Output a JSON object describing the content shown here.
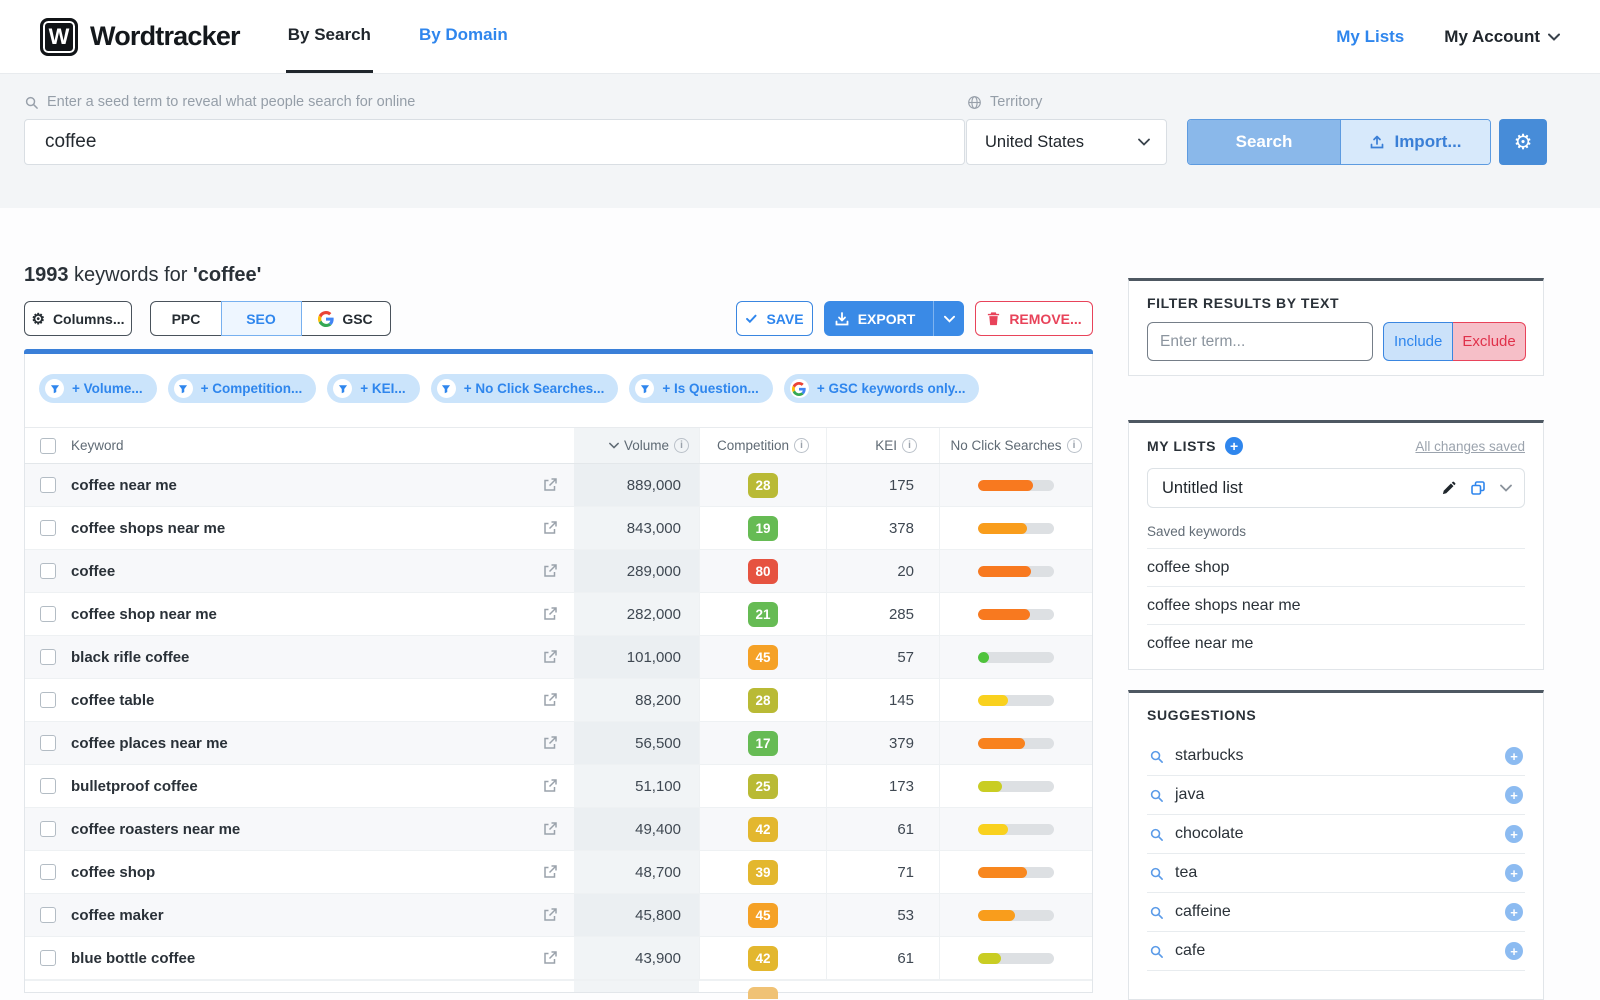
{
  "navbar": {
    "logo_letter": "W",
    "brand": "Wordtracker",
    "tab_by_search": "By Search",
    "tab_by_domain": "By Domain",
    "my_lists": "My Lists",
    "my_account": "My Account"
  },
  "search_panel": {
    "seed_label": "Enter a seed term to reveal what people search for online",
    "seed_value": "coffee",
    "territory_label": "Territory",
    "territory_value": "United States",
    "search_button": "Search",
    "import_button": "Import...",
    "accent_color": "#478cd8"
  },
  "results": {
    "count": "1993",
    "count_suffix": " keywords for ",
    "term": "'coffee'",
    "columns_button": "Columns...",
    "modes": {
      "ppc": "PPC",
      "seo": "SEO",
      "gsc": "GSC",
      "selected": "SEO"
    },
    "save_button": "SAVE",
    "export_button": "EXPORT",
    "remove_button": "REMOVE...",
    "filter_chips": [
      {
        "label": "+ Volume...",
        "icon": "funnel"
      },
      {
        "label": "+ Competition...",
        "icon": "funnel"
      },
      {
        "label": "+ KEI...",
        "icon": "funnel"
      },
      {
        "label": "+ No Click Searches...",
        "icon": "funnel"
      },
      {
        "label": "+ Is Question...",
        "icon": "funnel"
      },
      {
        "label": "+ GSC keywords only...",
        "icon": "google"
      }
    ],
    "table": {
      "headers": [
        "Keyword",
        "Volume",
        "Competition",
        "KEI",
        "No Click Searches"
      ],
      "rows": [
        {
          "keyword": "coffee near me",
          "volume": "889,000",
          "competition": "28",
          "competition_color": "#b9ba35",
          "kei": "175",
          "bar_pct": 72,
          "bar_color": "#f8791f"
        },
        {
          "keyword": "coffee shops near me",
          "volume": "843,000",
          "competition": "19",
          "competition_color": "#66bb54",
          "kei": "378",
          "bar_pct": 64,
          "bar_color": "#f99d1c"
        },
        {
          "keyword": "coffee",
          "volume": "289,000",
          "competition": "80",
          "competition_color": "#e65340",
          "kei": "20",
          "bar_pct": 70,
          "bar_color": "#f8791f"
        },
        {
          "keyword": "coffee shop near me",
          "volume": "282,000",
          "competition": "21",
          "competition_color": "#66bb54",
          "kei": "285",
          "bar_pct": 68,
          "bar_color": "#f8791f"
        },
        {
          "keyword": "black rifle coffee",
          "volume": "101,000",
          "competition": "45",
          "competition_color": "#f5a126",
          "kei": "57",
          "bar_pct": 14,
          "bar_color": "#4fc33c"
        },
        {
          "keyword": "coffee table",
          "volume": "88,200",
          "competition": "28",
          "competition_color": "#b9ba35",
          "kei": "145",
          "bar_pct": 40,
          "bar_color": "#f9d11e"
        },
        {
          "keyword": "coffee places near me",
          "volume": "56,500",
          "competition": "17",
          "competition_color": "#66bb54",
          "kei": "379",
          "bar_pct": 62,
          "bar_color": "#f8821e"
        },
        {
          "keyword": "bulletproof coffee",
          "volume": "51,100",
          "competition": "25",
          "competition_color": "#b9ba35",
          "kei": "173",
          "bar_pct": 32,
          "bar_color": "#c9cd23"
        },
        {
          "keyword": "coffee roasters near me",
          "volume": "49,400",
          "competition": "42",
          "competition_color": "#e3b72e",
          "kei": "61",
          "bar_pct": 40,
          "bar_color": "#f9d11e"
        },
        {
          "keyword": "coffee shop",
          "volume": "48,700",
          "competition": "39",
          "competition_color": "#e3b72e",
          "kei": "71",
          "bar_pct": 64,
          "bar_color": "#f8871e"
        },
        {
          "keyword": "coffee maker",
          "volume": "45,800",
          "competition": "45",
          "competition_color": "#f5a126",
          "kei": "53",
          "bar_pct": 49,
          "bar_color": "#f99d1c"
        },
        {
          "keyword": "blue bottle coffee",
          "volume": "43,900",
          "competition": "42",
          "competition_color": "#e3b72e",
          "kei": "61",
          "bar_pct": 30,
          "bar_color": "#c9cd23"
        }
      ]
    }
  },
  "sidebar": {
    "filter_panel": {
      "title": "FILTER RESULTS BY TEXT",
      "placeholder": "Enter term...",
      "include_label": "Include",
      "exclude_label": "Exclude"
    },
    "lists_panel": {
      "title": "MY LISTS",
      "status_link": "All changes saved",
      "list_name": "Untitled list",
      "saved_label": "Saved keywords",
      "saved_keywords": [
        "coffee shop",
        "coffee shops near me",
        "coffee near me"
      ]
    },
    "suggestions_panel": {
      "title": "SUGGESTIONS",
      "items": [
        "starbucks",
        "java",
        "chocolate",
        "tea",
        "caffeine",
        "cafe"
      ]
    }
  }
}
